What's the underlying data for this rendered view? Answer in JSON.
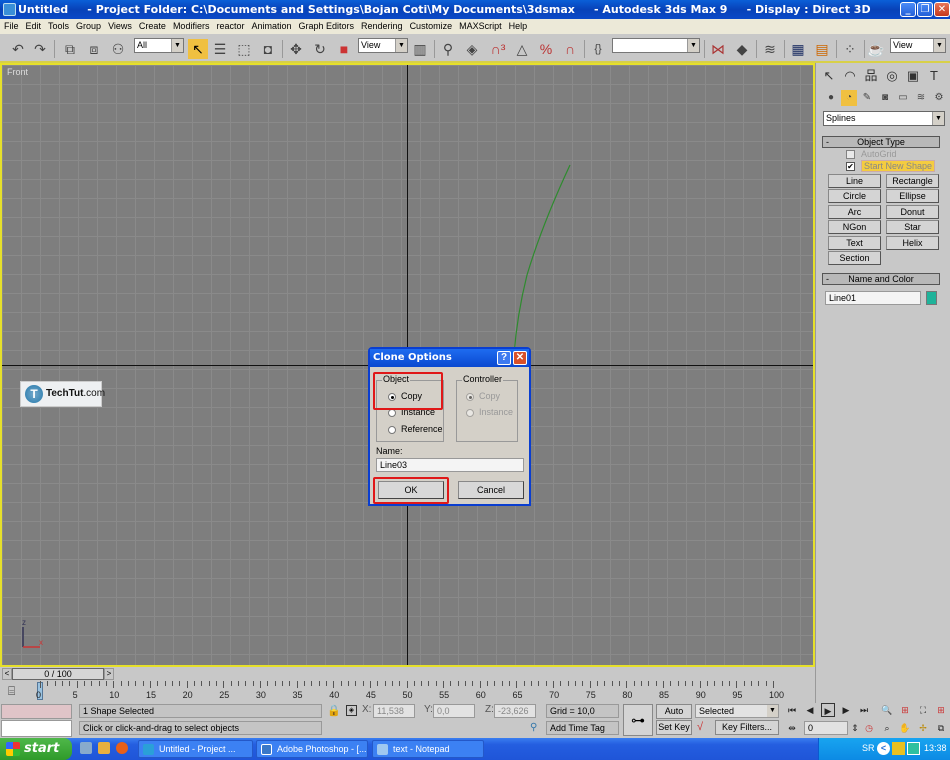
{
  "window": {
    "title": "Untitled     - Project Folder: C:\\Documents and Settings\\Bojan Coti\\My Documents\\3dsmax     - Autodesk 3ds Max 9     - Display : Direct 3D",
    "controls": [
      "minimize",
      "restore",
      "close"
    ]
  },
  "menu": [
    "File",
    "Edit",
    "Tools",
    "Group",
    "Views",
    "Create",
    "Modifiers",
    "reactor",
    "Animation",
    "Graph Editors",
    "Rendering",
    "Customize",
    "MAXScript",
    "Help"
  ],
  "toolbar": {
    "selection_filter": "All",
    "ref_coord": "View",
    "named_selection": "",
    "render_view": "View"
  },
  "viewport": {
    "label": "Front",
    "watermark": {
      "brand": "TechTut",
      "suffix": ".com",
      "logo_letter": "T"
    },
    "gizmo": {
      "z": "z",
      "x": "x"
    },
    "line_color": "#2e8b2e"
  },
  "command_panel": {
    "category": "Splines",
    "object_type": {
      "title": "Object Type",
      "autogrid": "AutoGrid",
      "start_new_shape": "Start New Shape",
      "start_new_shape_checked": true,
      "buttons": [
        "Line",
        "Rectangle",
        "Circle",
        "Ellipse",
        "Arc",
        "Donut",
        "NGon",
        "Star",
        "Text",
        "Helix",
        "Section"
      ]
    },
    "name_and_color": {
      "title": "Name and Color",
      "name": "Line01",
      "color": "#1fb39a"
    },
    "collapse_symbol": "-"
  },
  "dialog": {
    "title": "Clone Options",
    "object_group": "Object",
    "object_options": [
      "Copy",
      "Instance",
      "Reference"
    ],
    "object_selected": "Copy",
    "controller_group": "Controller",
    "controller_options": [
      "Copy",
      "Instance"
    ],
    "name_label": "Name:",
    "name_value": "Line03",
    "ok": "OK",
    "cancel": "Cancel",
    "help": "?",
    "close": "✕",
    "highlight_color": "#e01818"
  },
  "timeline": {
    "slider": "0 / 100",
    "prev": "<",
    "next": ">",
    "ticks": [
      "0",
      "5",
      "10",
      "15",
      "20",
      "25",
      "30",
      "35",
      "40",
      "45",
      "50",
      "55",
      "60",
      "65",
      "70",
      "75",
      "80",
      "85",
      "90",
      "95",
      "100"
    ]
  },
  "status": {
    "selection": "1 Shape Selected",
    "prompt": "Click or click-and-drag to select objects",
    "x_label": "X:",
    "x_value": "11,538",
    "y_label": "Y:",
    "y_value": "0,0",
    "z_label": "Z:",
    "z_value": "-23,626",
    "grid": "Grid = 10,0",
    "add_time_tag": "Add Time Tag",
    "auto_key": "Auto Key",
    "set_key": "Set Key",
    "key_mode": "Selected",
    "key_filters": "Key Filters...",
    "frame": "0"
  },
  "taskbar": {
    "start": "start",
    "tasks": [
      {
        "label": "Untitled     - Project ...",
        "color": "#2aa0d8"
      },
      {
        "label": "Adobe Photoshop - [...",
        "color": "#3a78c8"
      },
      {
        "label": "text - Notepad",
        "color": "#9fc8f0"
      }
    ],
    "lang": "SR",
    "time": "13:38"
  }
}
